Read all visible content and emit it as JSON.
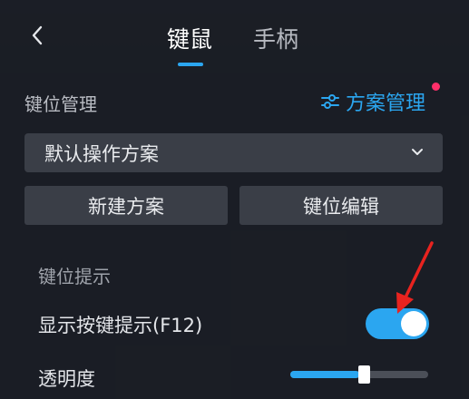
{
  "header": {
    "tabs": [
      {
        "label": "键鼠",
        "active": true
      },
      {
        "label": "手柄",
        "active": false
      }
    ]
  },
  "keymap": {
    "section_title": "键位管理",
    "scheme_manage_label": "方案管理",
    "scheme_manage_has_badge": true,
    "selected_scheme": "默认操作方案",
    "new_scheme_button": "新建方案",
    "edit_keys_button": "键位编辑"
  },
  "hints": {
    "section_title": "键位提示",
    "show_hints_label": "显示按键提示(F12)",
    "show_hints_enabled": true,
    "opacity_label": "透明度",
    "opacity_value": 0.5
  },
  "colors": {
    "accent": "#2ba6f0",
    "badge": "#ff2f6a",
    "annotation_arrow": "#e8231f"
  }
}
